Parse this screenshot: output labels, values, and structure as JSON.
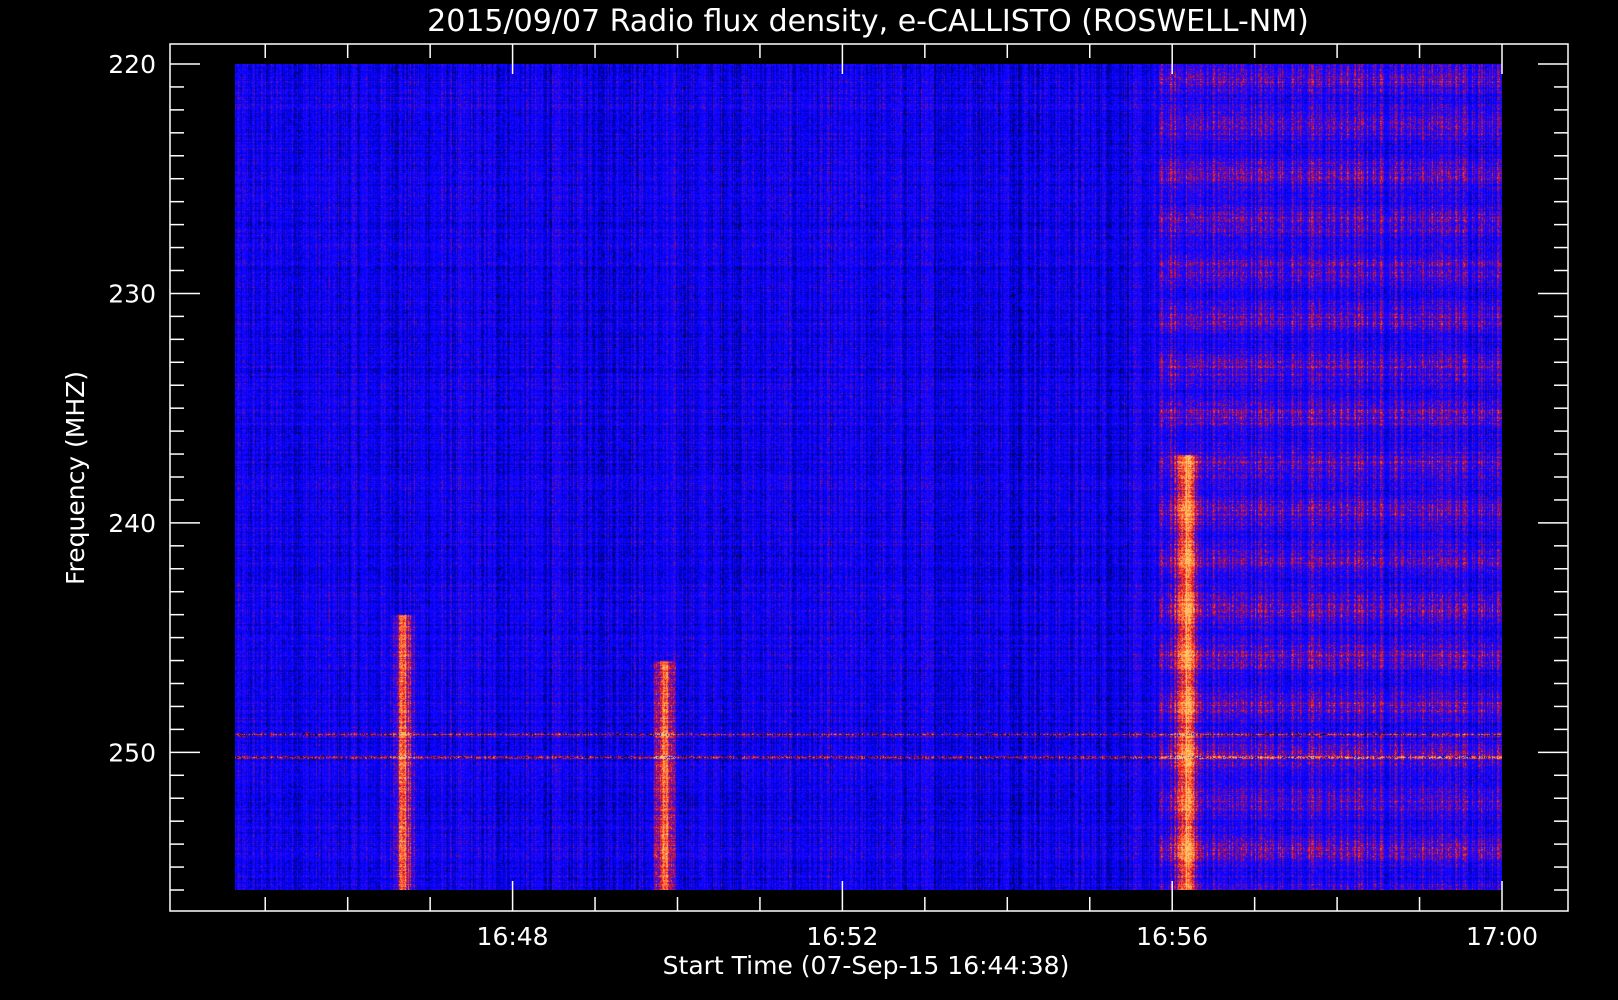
{
  "chart_data": {
    "type": "heatmap",
    "title": "2015/09/07  Radio flux density, e-CALLISTO (ROSWELL-NM)",
    "xlabel": "Start Time (07-Sep-15 16:44:38)",
    "ylabel": "Frequency (MHZ)",
    "x_axis": {
      "unit": "time",
      "range": [
        "16:44:38",
        "17:00:00"
      ],
      "major_ticks": [
        "16:48",
        "16:52",
        "16:56",
        "17:00"
      ]
    },
    "y_axis": {
      "unit": "MHz",
      "range": [
        220,
        256
      ],
      "inverted": true,
      "major_ticks": [
        220,
        230,
        240,
        250
      ]
    },
    "colormap": {
      "low": "#000000",
      "mid": "#1a10ff",
      "high": "#ff2010",
      "peak": "#ffcc66"
    },
    "features": [
      {
        "kind": "persistent-line",
        "frequency_mhz": 250.2
      },
      {
        "kind": "persistent-line",
        "frequency_mhz": 249.2
      },
      {
        "kind": "burst",
        "time": "16:56:10",
        "freq_range_mhz": [
          237,
          256
        ]
      },
      {
        "kind": "burst",
        "time": "16:49:50",
        "freq_range_mhz": [
          246,
          256
        ]
      },
      {
        "kind": "burst",
        "time": "16:46:40",
        "freq_range_mhz": [
          244,
          256
        ]
      },
      {
        "kind": "enhanced-region",
        "time_range": [
          "16:55:50",
          "17:00:00"
        ],
        "freq_range_mhz": [
          220,
          256
        ]
      }
    ]
  }
}
